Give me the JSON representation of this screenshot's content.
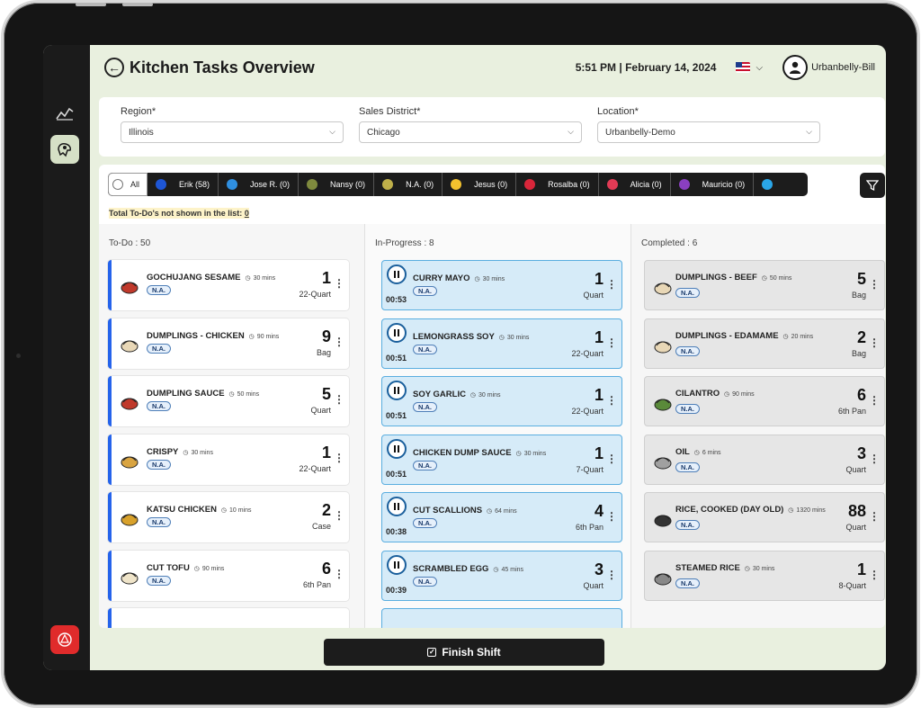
{
  "header": {
    "title": "Kitchen Tasks Overview",
    "datetime": "5:51 PM | February 14, 2024",
    "user": "Urbanbelly-Bill"
  },
  "filters": {
    "region": {
      "label": "Region*",
      "value": "Illinois"
    },
    "district": {
      "label": "Sales District*",
      "value": "Chicago"
    },
    "location": {
      "label": "Location*",
      "value": "Urbanbelly-Demo"
    }
  },
  "assignees": [
    {
      "label": "All",
      "color": "#ffffff"
    },
    {
      "label": "Erik (58)",
      "color": "#1e56d6"
    },
    {
      "label": "Jose R. (0)",
      "color": "#2f8fe0"
    },
    {
      "label": "Nansy (0)",
      "color": "#7f8a3e"
    },
    {
      "label": "N.A. (0)",
      "color": "#bfb04a"
    },
    {
      "label": "Jesus (0)",
      "color": "#f2c12e"
    },
    {
      "label": "Rosalba (0)",
      "color": "#d9263a"
    },
    {
      "label": "Alicia (0)",
      "color": "#e23b55"
    },
    {
      "label": "Mauricio (0)",
      "color": "#8a3fc0"
    },
    {
      "label": "",
      "color": "#2aa6e8"
    }
  ],
  "not_shown": {
    "label": "Total To-Do's not shown in the list:",
    "value": "0"
  },
  "columns": {
    "todo": {
      "title": "To-Do : 50",
      "cards": [
        {
          "name": "GOCHUJANG SESAME",
          "duration": "30 mins",
          "badge": "N.A.",
          "qty": "1",
          "unit": "22-Quart",
          "icon": "sauce-container-icon"
        },
        {
          "name": "DUMPLINGS - CHICKEN",
          "duration": "90 mins",
          "badge": "N.A.",
          "qty": "9",
          "unit": "Bag",
          "icon": "dumpling-icon"
        },
        {
          "name": "DUMPLING SAUCE",
          "duration": "50 mins",
          "badge": "N.A.",
          "qty": "5",
          "unit": "Quart",
          "icon": "sauce-bowl-icon"
        },
        {
          "name": "CRISPY",
          "duration": "30 mins",
          "badge": "N.A.",
          "qty": "1",
          "unit": "22-Quart",
          "icon": "crispy-bowl-icon"
        },
        {
          "name": "KATSU CHICKEN",
          "duration": "10 mins",
          "badge": "N.A.",
          "qty": "2",
          "unit": "Case",
          "icon": "katsu-jar-icon"
        },
        {
          "name": "CUT TOFU",
          "duration": "90 mins",
          "badge": "N.A.",
          "qty": "6",
          "unit": "6th Pan",
          "icon": "tofu-icon"
        }
      ]
    },
    "progress": {
      "title": "In-Progress : 8",
      "cards": [
        {
          "name": "CURRY MAYO",
          "duration": "30 mins",
          "badge": "N.A.",
          "qty": "1",
          "unit": "Quart",
          "timer": "00:53"
        },
        {
          "name": "LEMONGRASS SOY",
          "duration": "30 mins",
          "badge": "N.A.",
          "qty": "1",
          "unit": "22-Quart",
          "timer": "00:51"
        },
        {
          "name": "SOY GARLIC",
          "duration": "30 mins",
          "badge": "N.A.",
          "qty": "1",
          "unit": "22-Quart",
          "timer": "00:51"
        },
        {
          "name": "CHICKEN DUMP SAUCE",
          "duration": "30 mins",
          "badge": "N.A.",
          "qty": "1",
          "unit": "7-Quart",
          "timer": "00:51"
        },
        {
          "name": "CUT SCALLIONS",
          "duration": "64 mins",
          "badge": "N.A.",
          "qty": "4",
          "unit": "6th Pan",
          "timer": "00:38"
        },
        {
          "name": "SCRAMBLED EGG",
          "duration": "45 mins",
          "badge": "N.A.",
          "qty": "3",
          "unit": "Quart",
          "timer": "00:39"
        }
      ]
    },
    "completed": {
      "title": "Completed : 6",
      "cards": [
        {
          "name": "DUMPLINGS - BEEF",
          "duration": "50 mins",
          "badge": "N.A.",
          "qty": "5",
          "unit": "Bag",
          "icon": "dumpling-icon"
        },
        {
          "name": "DUMPLINGS - EDAMAME",
          "duration": "20 mins",
          "badge": "N.A.",
          "qty": "2",
          "unit": "Bag",
          "icon": "dumpling-icon"
        },
        {
          "name": "CILANTRO",
          "duration": "90 mins",
          "badge": "N.A.",
          "qty": "6",
          "unit": "6th Pan",
          "icon": "cilantro-icon"
        },
        {
          "name": "OIL",
          "duration": "6 mins",
          "badge": "N.A.",
          "qty": "3",
          "unit": "Quart",
          "icon": "oil-bottle-icon"
        },
        {
          "name": "RICE, COOKED (DAY OLD)",
          "duration": "1320 mins",
          "badge": "N.A.",
          "qty": "88",
          "unit": "Quart",
          "icon": "rice-bowl-icon"
        },
        {
          "name": "STEAMED RICE",
          "duration": "30 mins",
          "badge": "N.A.",
          "qty": "1",
          "unit": "8-Quart",
          "icon": "covered-dish-icon"
        }
      ]
    }
  },
  "finish_button": "Finish Shift"
}
